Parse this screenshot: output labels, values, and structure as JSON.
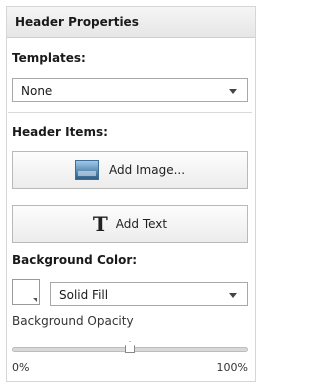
{
  "panel": {
    "title": "Header Properties"
  },
  "templates": {
    "label": "Templates:",
    "selected": "None"
  },
  "header_items": {
    "label": "Header Items:",
    "add_image_label": "Add Image...",
    "add_text_label": "Add Text",
    "add_image_icon": "image-icon",
    "add_text_icon": "text-T-icon"
  },
  "background": {
    "label": "Background Color:",
    "swatch_color": "#ffffff",
    "fill_selected": "Solid Fill"
  },
  "opacity": {
    "label": "Background Opacity",
    "min_label": "0%",
    "max_label": "100%",
    "value_fraction": 0.5
  }
}
